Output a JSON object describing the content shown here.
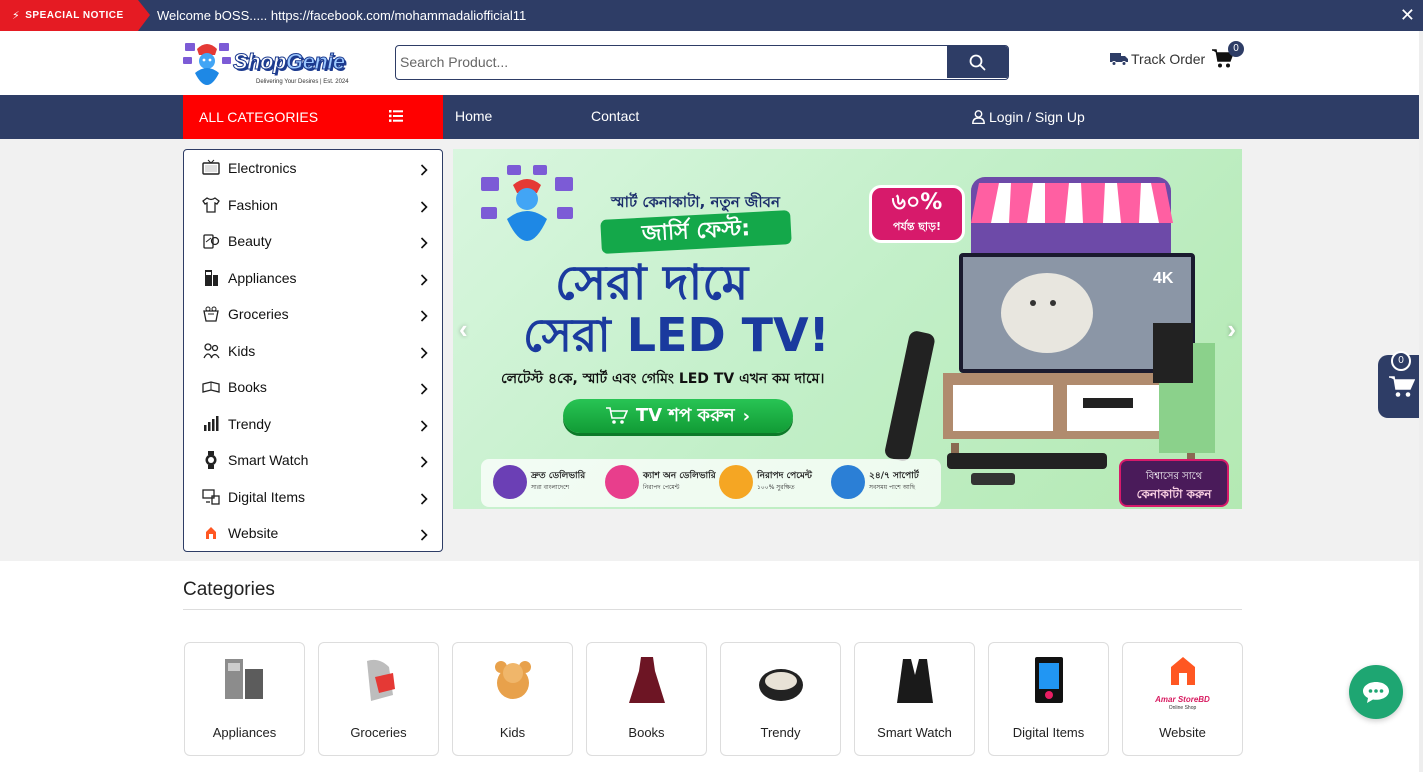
{
  "notice": {
    "tag": "SPEACIAL NOTICE",
    "text": "Welcome bOSS..... https://facebook.com/mohammadaliofficial11",
    "close": "✕"
  },
  "header": {
    "logo_brand_1": "Shop",
    "logo_brand_2": "Genie",
    "logo_tagline": "Delivering Your Desires | Est. 2024",
    "search_placeholder": "Search Product...",
    "track_order": "Track Order",
    "cart_count": "0"
  },
  "nav": {
    "all_categories": "ALL CATEGORIES",
    "home": "Home",
    "contact": "Contact",
    "login": "Login / Sign Up"
  },
  "sidebar": {
    "items": [
      {
        "label": "Electronics",
        "icon": "tv-icon"
      },
      {
        "label": "Fashion",
        "icon": "shirt-icon"
      },
      {
        "label": "Beauty",
        "icon": "beauty-icon"
      },
      {
        "label": "Appliances",
        "icon": "appliance-icon"
      },
      {
        "label": "Groceries",
        "icon": "grocery-icon"
      },
      {
        "label": "Kids",
        "icon": "kids-icon"
      },
      {
        "label": "Books",
        "icon": "books-icon"
      },
      {
        "label": "Trendy",
        "icon": "trendy-icon"
      },
      {
        "label": "Smart Watch",
        "icon": "watch-icon"
      },
      {
        "label": "Digital Items",
        "icon": "digital-icon"
      },
      {
        "label": "Website",
        "icon": "website-icon"
      }
    ]
  },
  "banner": {
    "headline": "স্মার্ট কেনাকাটা, নতুন জীবন",
    "pill": "জার্সি ফেস্ট:",
    "big1": "সেরা দামে",
    "big2": "সেরা LED TV!",
    "sub": "লেটেস্ট ৪কে, স্মার্ট এবং গেমিং LED TV এখন কম দামে।",
    "cta": "TV শপ করুন",
    "discount": "৬০%",
    "discount_sub": "পর্যন্ত ছাড়!",
    "tv_label": "4K",
    "features": [
      {
        "title": "দ্রুত ডেলিভারি",
        "sub": "সারা বাংলাদেশে",
        "color": "#6b3fb5"
      },
      {
        "title": "ক্যাশ অন ডেলিভারি",
        "sub": "নিরাপদ পেমেন্ট",
        "color": "#e83e8c"
      },
      {
        "title": "নিরাপদ পেমেন্ট",
        "sub": "১০০% সুরক্ষিত",
        "color": "#f5a623"
      },
      {
        "title": "২৪/৭ সাপোর্ট",
        "sub": "সবসময় পাশে আছি",
        "color": "#2b7fd6"
      }
    ],
    "trust_1": "বিশ্বাসের সাথে",
    "trust_2": "কেনাকাটা করুন"
  },
  "categories": {
    "title": "Categories",
    "cards": [
      {
        "label": "Appliances"
      },
      {
        "label": "Groceries"
      },
      {
        "label": "Kids"
      },
      {
        "label": "Books"
      },
      {
        "label": "Trendy"
      },
      {
        "label": "Smart Watch"
      },
      {
        "label": "Digital Items"
      },
      {
        "label": "Website",
        "logo_text": "Amar StoreBD",
        "logo_sub": "Online Shop"
      }
    ]
  },
  "floating_cart": {
    "count": "0"
  },
  "colors": {
    "primary": "#2e3d66",
    "accent": "#ff0000",
    "chat": "#1ea672"
  }
}
